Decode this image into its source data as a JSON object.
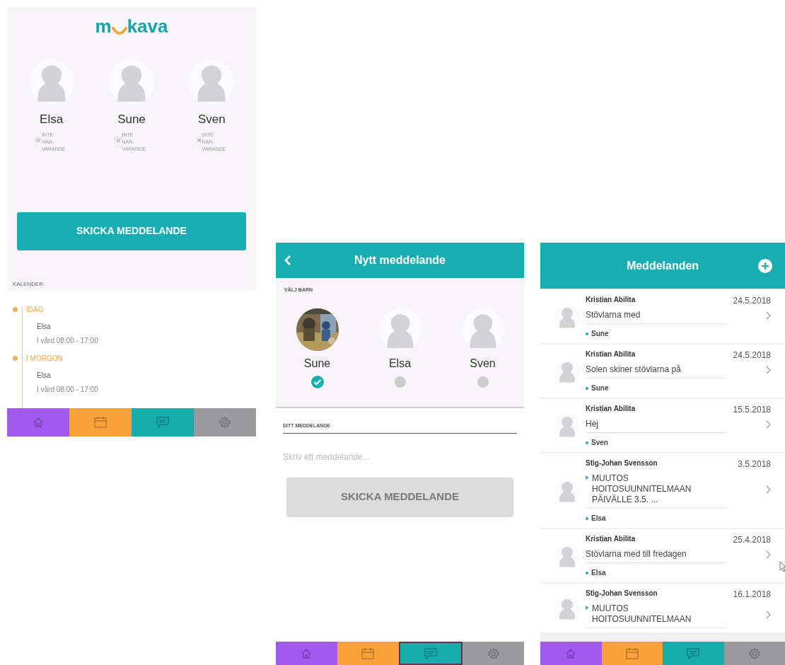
{
  "home_screen": {
    "logo": {
      "left": "m",
      "right": "kava"
    },
    "children": [
      {
        "name": "Elsa",
        "status": "INTE NÄR-VARANDE"
      },
      {
        "name": "Sune",
        "status": "INTE NÄR-VARANDE"
      },
      {
        "name": "Sven",
        "status": "INTE NÄR-VARANDE"
      }
    ],
    "send_button": "SKICKA MEDDELANDE",
    "calendar": {
      "heading": "KALENDER",
      "days": [
        {
          "label": "IDAG",
          "entries": [
            {
              "child": "Elsa",
              "detail": "I vård 08:00 - 17:00"
            }
          ]
        },
        {
          "label": "I MORGON",
          "entries": [
            {
              "child": "Elsa",
              "detail": "I vård 08:00 - 17:00"
            }
          ]
        }
      ]
    },
    "tab_bar": [
      {
        "kind": "home",
        "color": "#a259f0",
        "focused": false
      },
      {
        "kind": "calendar",
        "color": "#f9a23a",
        "focused": false
      },
      {
        "kind": "messages",
        "color": "#18acad",
        "focused": false
      },
      {
        "kind": "settings",
        "color": "#9b9a9c",
        "focused": false
      }
    ]
  },
  "new_message_screen": {
    "title": "Nytt meddelande",
    "section_children": "VÄLJ BARN",
    "children": [
      {
        "name": "Sune",
        "photo": true,
        "selected": true
      },
      {
        "name": "Elsa",
        "photo": false,
        "selected": false
      },
      {
        "name": "Sven",
        "photo": false,
        "selected": false
      }
    ],
    "section_message": "DITT MEDDELANDE",
    "placeholder": "Skriv ett meddelande...",
    "send_button": {
      "label": "SKICKA MEDDELANDE",
      "disabled": true
    },
    "tab_bar": [
      {
        "kind": "home",
        "color": "#a259f0",
        "focused": false
      },
      {
        "kind": "calendar",
        "color": "#f9a23a",
        "focused": false
      },
      {
        "kind": "messages",
        "color": "#18acad",
        "focused": true
      },
      {
        "kind": "settings",
        "color": "#9b9a9c",
        "focused": false
      }
    ]
  },
  "messages_screen": {
    "title": "Meddelanden",
    "messages": [
      {
        "sender": "Kristian Abilita",
        "date": "24.5.2018",
        "text": "Stövlarna med",
        "child": "Sune",
        "kind": "plain"
      },
      {
        "sender": "Kristian Abilita",
        "date": "24.5.2018",
        "text": "Solen skiner stövlarna på",
        "child": "Sune",
        "kind": "plain"
      },
      {
        "sender": "Kristian Abilita",
        "date": "15.5.2018",
        "text": "Hej",
        "child": "Sven",
        "kind": "plain"
      },
      {
        "sender": "Stig-Johan Svensson",
        "date": "3.5.2018",
        "text": "MUUTOS HOITOSUUNNITELMAAN PÄIVÄLLE 3.5. ...",
        "child": "Elsa",
        "kind": "notice"
      },
      {
        "sender": "Kristian Abilita",
        "date": "25.4.2018",
        "text": "Stövlarna med till fredagen",
        "child": "Elsa",
        "kind": "plain"
      },
      {
        "sender": "Stig-Johan Svensson",
        "date": "16.1.2018",
        "text": "MUUTOS HOITOSUUNNITELMAAN",
        "kind": "notice"
      }
    ],
    "tab_bar": [
      {
        "kind": "home",
        "color": "#a259f0",
        "focused": false
      },
      {
        "kind": "calendar",
        "color": "#f9a23a",
        "focused": false
      },
      {
        "kind": "messages",
        "color": "#18acad",
        "focused": false
      },
      {
        "kind": "settings",
        "color": "#9b9a9c",
        "focused": false
      }
    ]
  }
}
